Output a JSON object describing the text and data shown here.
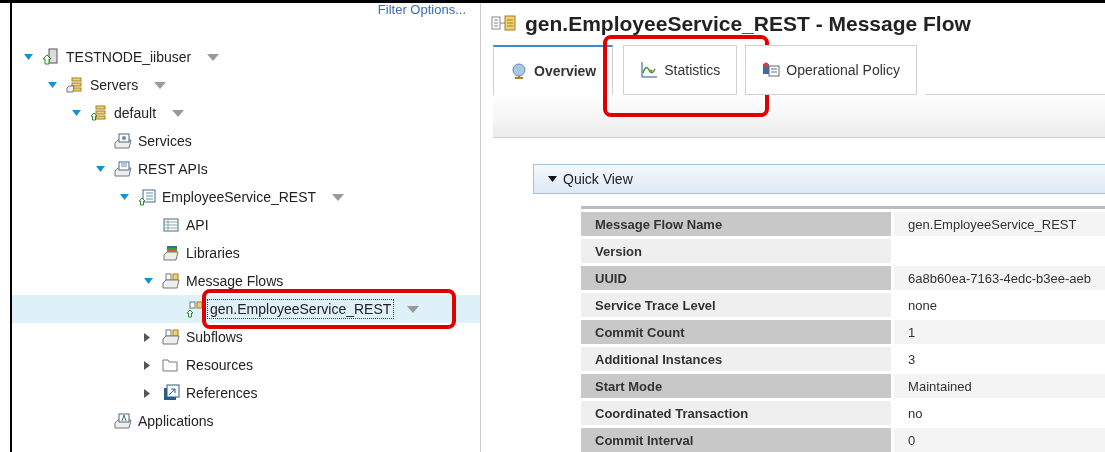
{
  "navigator": {
    "filter_link": "Filter Options...",
    "tree": [
      {
        "label": "TESTNODE_iibuser",
        "kind": "node",
        "expanded": true,
        "menu": true,
        "selected": false,
        "highlighted": false,
        "children": [
          {
            "label": "Servers",
            "kind": "servers",
            "expanded": true,
            "menu": true,
            "selected": false,
            "highlighted": false,
            "children": [
              {
                "label": "default",
                "kind": "server",
                "expanded": true,
                "menu": true,
                "selected": false,
                "highlighted": false,
                "children": [
                  {
                    "label": "Services",
                    "kind": "services",
                    "menu": false,
                    "selected": false,
                    "highlighted": false
                  },
                  {
                    "label": "REST APIs",
                    "kind": "rest-apis",
                    "expanded": true,
                    "menu": false,
                    "selected": false,
                    "highlighted": false,
                    "children": [
                      {
                        "label": "EmployeeService_REST",
                        "kind": "rest-api",
                        "expanded": true,
                        "menu": true,
                        "selected": false,
                        "highlighted": false,
                        "children": [
                          {
                            "label": "API",
                            "kind": "api",
                            "menu": false,
                            "selected": false,
                            "highlighted": false
                          },
                          {
                            "label": "Libraries",
                            "kind": "libraries",
                            "menu": false,
                            "selected": false,
                            "highlighted": false
                          },
                          {
                            "label": "Message Flows",
                            "kind": "flows",
                            "expanded": true,
                            "menu": false,
                            "selected": false,
                            "highlighted": false,
                            "children": [
                              {
                                "label": "gen.EmployeeService_REST",
                                "kind": "flow",
                                "menu": true,
                                "selected": true,
                                "highlighted": true
                              }
                            ]
                          },
                          {
                            "label": "Subflows",
                            "kind": "flows",
                            "expanded": false,
                            "menu": false,
                            "selected": false,
                            "highlighted": false
                          },
                          {
                            "label": "Resources",
                            "kind": "folder",
                            "expanded": false,
                            "menu": false,
                            "selected": false,
                            "highlighted": false
                          },
                          {
                            "label": "References",
                            "kind": "references",
                            "expanded": false,
                            "menu": false,
                            "selected": false,
                            "highlighted": false
                          }
                        ]
                      }
                    ]
                  },
                  {
                    "label": "Applications",
                    "kind": "applications",
                    "menu": false,
                    "selected": false,
                    "highlighted": false
                  }
                ]
              }
            ]
          }
        ]
      }
    ]
  },
  "editor": {
    "title": "gen.EmployeeService_REST - Message Flow",
    "tabs": [
      {
        "label": "Overview",
        "kind": "overview",
        "selected": true,
        "highlighted": false
      },
      {
        "label": "Statistics",
        "kind": "statistics",
        "selected": false,
        "highlighted": true
      },
      {
        "label": "Operational Policy",
        "kind": "policy",
        "selected": false,
        "highlighted": false
      }
    ],
    "quick_view": {
      "title": "Quick View",
      "expanded": true,
      "rows": [
        {
          "label": "Message Flow Name",
          "value": "gen.EmployeeService_REST"
        },
        {
          "label": "Version",
          "value": ""
        },
        {
          "label": "UUID",
          "value": "6a8b60ea-7163-4edc-b3ee-aeb"
        },
        {
          "label": "Service Trace Level",
          "value": "none"
        },
        {
          "label": "Commit Count",
          "value": "1"
        },
        {
          "label": "Additional Instances",
          "value": "3"
        },
        {
          "label": "Start Mode",
          "value": "Maintained"
        },
        {
          "label": "Coordinated Transaction",
          "value": "no"
        },
        {
          "label": "Commit Interval",
          "value": "0"
        }
      ]
    }
  }
}
